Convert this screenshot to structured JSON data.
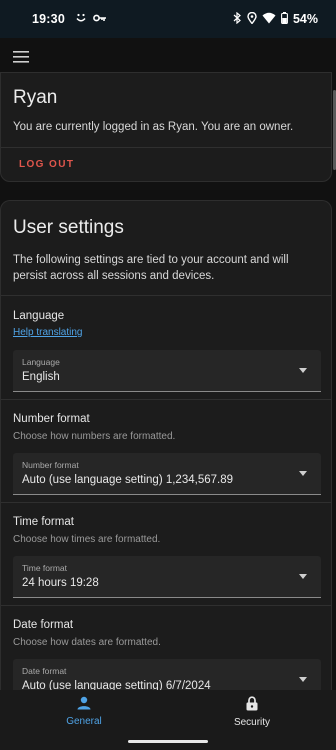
{
  "status_bar": {
    "time": "19:30",
    "battery_percent": "54%",
    "left_icons": [
      "smile-icon",
      "key-icon"
    ],
    "right_icons": [
      "bluetooth-icon",
      "location-icon",
      "wifi-icon",
      "battery-icon"
    ]
  },
  "toolbar": {
    "menu_icon": "menu-icon"
  },
  "account": {
    "name": "Ryan",
    "description": "You are currently logged in as Ryan. You are an owner.",
    "logout_label": "LOG OUT"
  },
  "settings": {
    "title": "User settings",
    "description": "The following settings are tied to your account and will persist across all sessions and devices.",
    "language": {
      "title": "Language",
      "help_link": "Help translating",
      "field_label": "Language",
      "value": "English"
    },
    "number_format": {
      "title": "Number format",
      "subtitle": "Choose how numbers are formatted.",
      "field_label": "Number format",
      "value": "Auto (use language setting) 1,234,567.89"
    },
    "time_format": {
      "title": "Time format",
      "subtitle": "Choose how times are formatted.",
      "field_label": "Time format",
      "value": "24 hours 19:28"
    },
    "date_format": {
      "title": "Date format",
      "subtitle": "Choose how dates are formatted.",
      "field_label": "Date format",
      "value": "Auto (use language setting) 6/7/2024"
    }
  },
  "bottom_nav": {
    "items": [
      {
        "label": "General",
        "icon": "person-icon",
        "active": true
      },
      {
        "label": "Security",
        "icon": "lock-icon",
        "active": false
      }
    ]
  },
  "colors": {
    "accent": "#4fa3e6",
    "danger": "#e0564c",
    "background": "#111111",
    "card": "#1c1c1c"
  }
}
